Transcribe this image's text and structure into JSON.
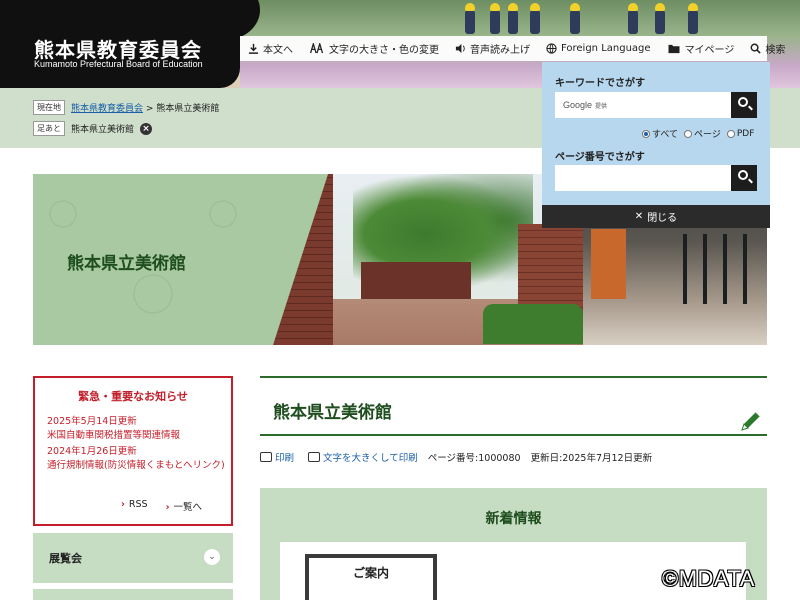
{
  "site": {
    "title": "熊本県教育委員会",
    "subtitle": "Kumamoto Prefectural Board of Education"
  },
  "topnav": {
    "items": [
      {
        "label": "本文へ",
        "icon": "arrow-down-icon"
      },
      {
        "label": "文字の大きさ・色の変更",
        "icon": "text-size-icon"
      },
      {
        "label": "音声読み上げ",
        "icon": "speaker-icon"
      },
      {
        "label": "Foreign Language",
        "icon": "globe-icon"
      },
      {
        "label": "マイページ",
        "icon": "folder-icon"
      },
      {
        "label": "検索",
        "icon": "search-icon"
      }
    ]
  },
  "breadcrumb": {
    "current_tag": "現在地",
    "home_link": "熊本県教育委員会",
    "separator": ">",
    "current_page": "熊本県立美術館",
    "history_tag": "足あと",
    "history_item": "熊本県立美術館",
    "remove_symbol": "×"
  },
  "search_panel": {
    "keyword_label": "キーワードでさがす",
    "google_label": "Google",
    "google_sub": "提供",
    "radio_options": [
      "すべて",
      "ページ",
      "PDF"
    ],
    "radio_selected": "すべて",
    "page_number_label": "ページ番号でさがす",
    "close_label": "閉じる",
    "close_symbol": "✕"
  },
  "hero": {
    "title": "熊本県立美術館"
  },
  "notice": {
    "title": "緊急・重要なお知らせ",
    "items": [
      {
        "date": "2025年5月14日更新",
        "text": "米国自動車関税措置等関連情報"
      },
      {
        "date": "2024年1月26日更新",
        "text": "通行規制情報(防災情報くまもとへリンク)"
      }
    ],
    "rss_label": "RSS",
    "list_label": "一覧へ"
  },
  "accordion": {
    "first_label": "展覧会"
  },
  "page": {
    "heading": "熊本県立美術館",
    "print_label": "印刷",
    "large_print_label": "文字を大きくして印刷",
    "page_number": "ページ番号:1000080",
    "updated": "更新日:2025年7月12日更新"
  },
  "news": {
    "title": "新着情報",
    "thumb_text": "ご案内"
  },
  "watermark": "©MDATA",
  "colors": {
    "brand_green": "#1e4d1e",
    "alert_red": "#c41e2a",
    "panel_blue": "#b7d7ee",
    "band_green": "#cfdfcb"
  }
}
